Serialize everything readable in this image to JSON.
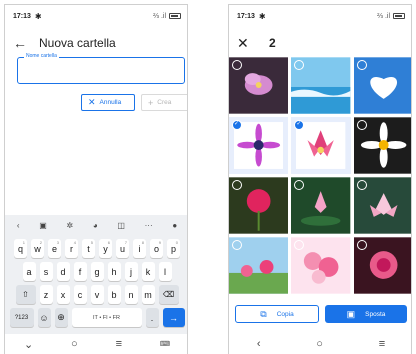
{
  "left": {
    "status": {
      "time": "17:13",
      "signal": "⅔ .il"
    },
    "appbar": {
      "title": "Nuova cartella"
    },
    "field": {
      "label": "Nome cartella",
      "value": ""
    },
    "buttons": {
      "cancel": "Annulla",
      "create": "Crea"
    },
    "keyboard": {
      "row1": [
        "q",
        "w",
        "e",
        "r",
        "t",
        "y",
        "u",
        "i",
        "o",
        "p"
      ],
      "row1_sup": [
        "1",
        "2",
        "3",
        "4",
        "5",
        "6",
        "7",
        "8",
        "9",
        "0"
      ],
      "row2": [
        "a",
        "s",
        "d",
        "f",
        "g",
        "h",
        "j",
        "k",
        "l"
      ],
      "row3": [
        "z",
        "x",
        "c",
        "v",
        "b",
        "n",
        "m"
      ],
      "num_key": "?123",
      "space_label": "IT • FI • FR",
      "period": "."
    }
  },
  "right": {
    "status": {
      "time": "17:13",
      "signal": "⅔ .il"
    },
    "appbar": {
      "count": "2"
    },
    "actions": {
      "copy": "Copia",
      "move": "Sposta"
    }
  },
  "colors": {
    "accent": "#1a73e8"
  }
}
